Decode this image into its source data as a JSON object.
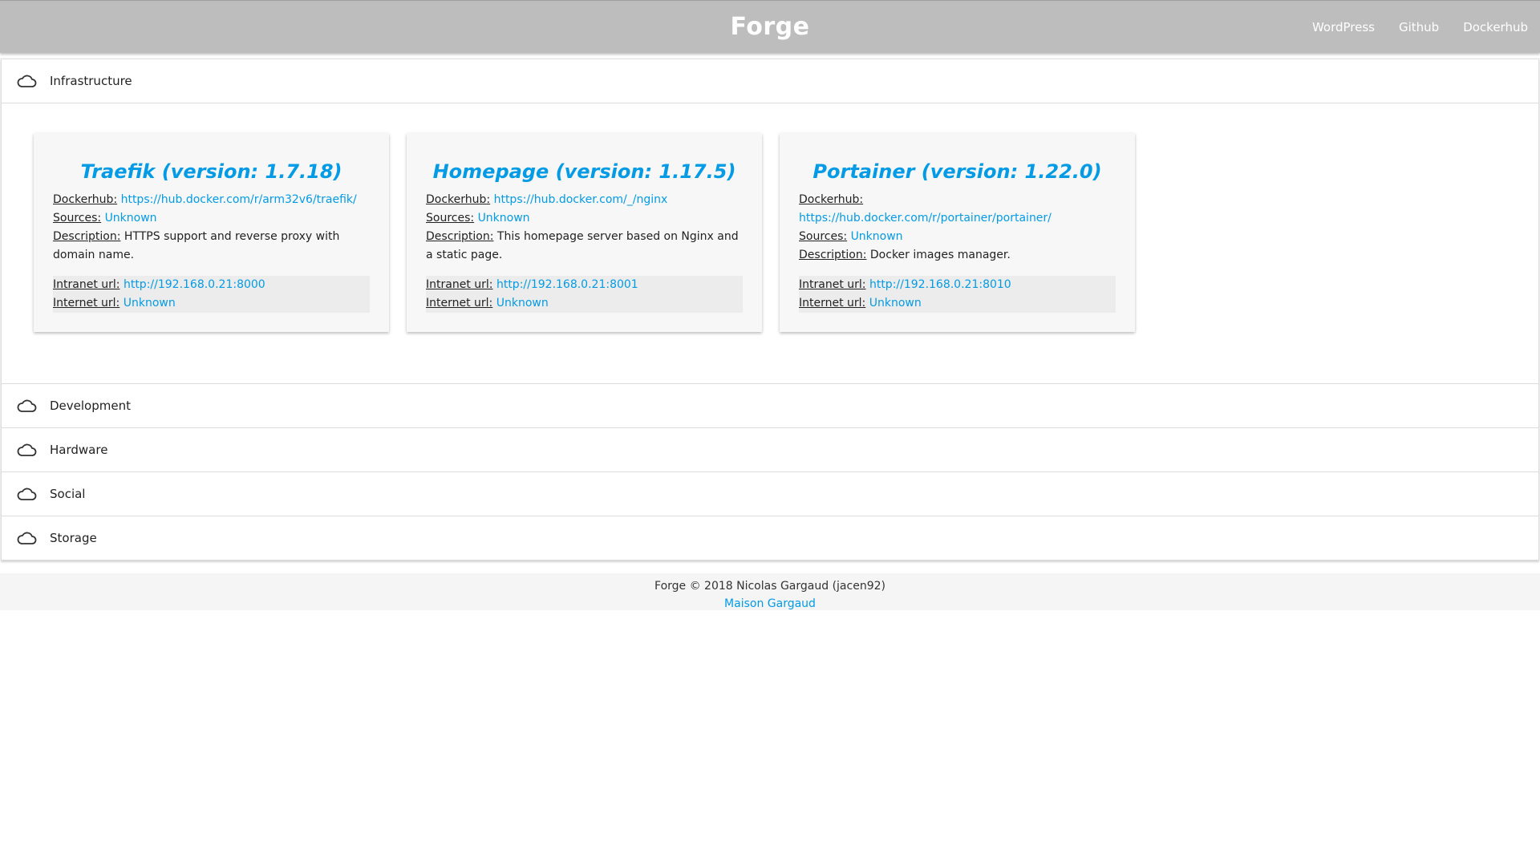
{
  "app": {
    "title": "Forge"
  },
  "nav": {
    "links": [
      "WordPress",
      "Github",
      "Dockerhub"
    ]
  },
  "sections": [
    {
      "label": "Infrastructure",
      "icon": "cloud-icon",
      "expanded": true
    },
    {
      "label": "Development",
      "icon": "cloud-icon"
    },
    {
      "label": "Hardware",
      "icon": "cloud-icon"
    },
    {
      "label": "Social",
      "icon": "cloud-icon"
    },
    {
      "label": "Storage",
      "icon": "cloud-icon"
    }
  ],
  "labels": {
    "dockerhub": "Dockerhub:",
    "sources": "Sources:",
    "description": "Description:",
    "intranet": "Intranet url:",
    "internet": "Internet url:"
  },
  "cards": [
    {
      "title": "Traefik (version: 1.7.18)",
      "dockerhub": "https://hub.docker.com/r/arm32v6/traefik/",
      "sources": "Unknown",
      "description": "HTTPS support and reverse proxy with domain name.",
      "intranet": "http://192.168.0.21:8000",
      "internet": "Unknown"
    },
    {
      "title": "Homepage (version: 1.17.5)",
      "dockerhub": "https://hub.docker.com/_/nginx",
      "sources": "Unknown",
      "description": "This homepage server based on Nginx and a static page.",
      "intranet": "http://192.168.0.21:8001",
      "internet": "Unknown"
    },
    {
      "title": "Portainer (version: 1.22.0)",
      "dockerhub": "https://hub.docker.com/r/portainer/portainer/",
      "sources": "Unknown",
      "description": "Docker images manager.",
      "intranet": "http://192.168.0.21:8010",
      "internet": "Unknown"
    }
  ],
  "footer": {
    "copyright": "Forge © 2018 Nicolas Gargaud (jacen92)",
    "site": "Maison Gargaud"
  },
  "colors": {
    "navbar": "#bdbdbd",
    "link": "#039be5",
    "card_bg": "#f7f7f7"
  }
}
